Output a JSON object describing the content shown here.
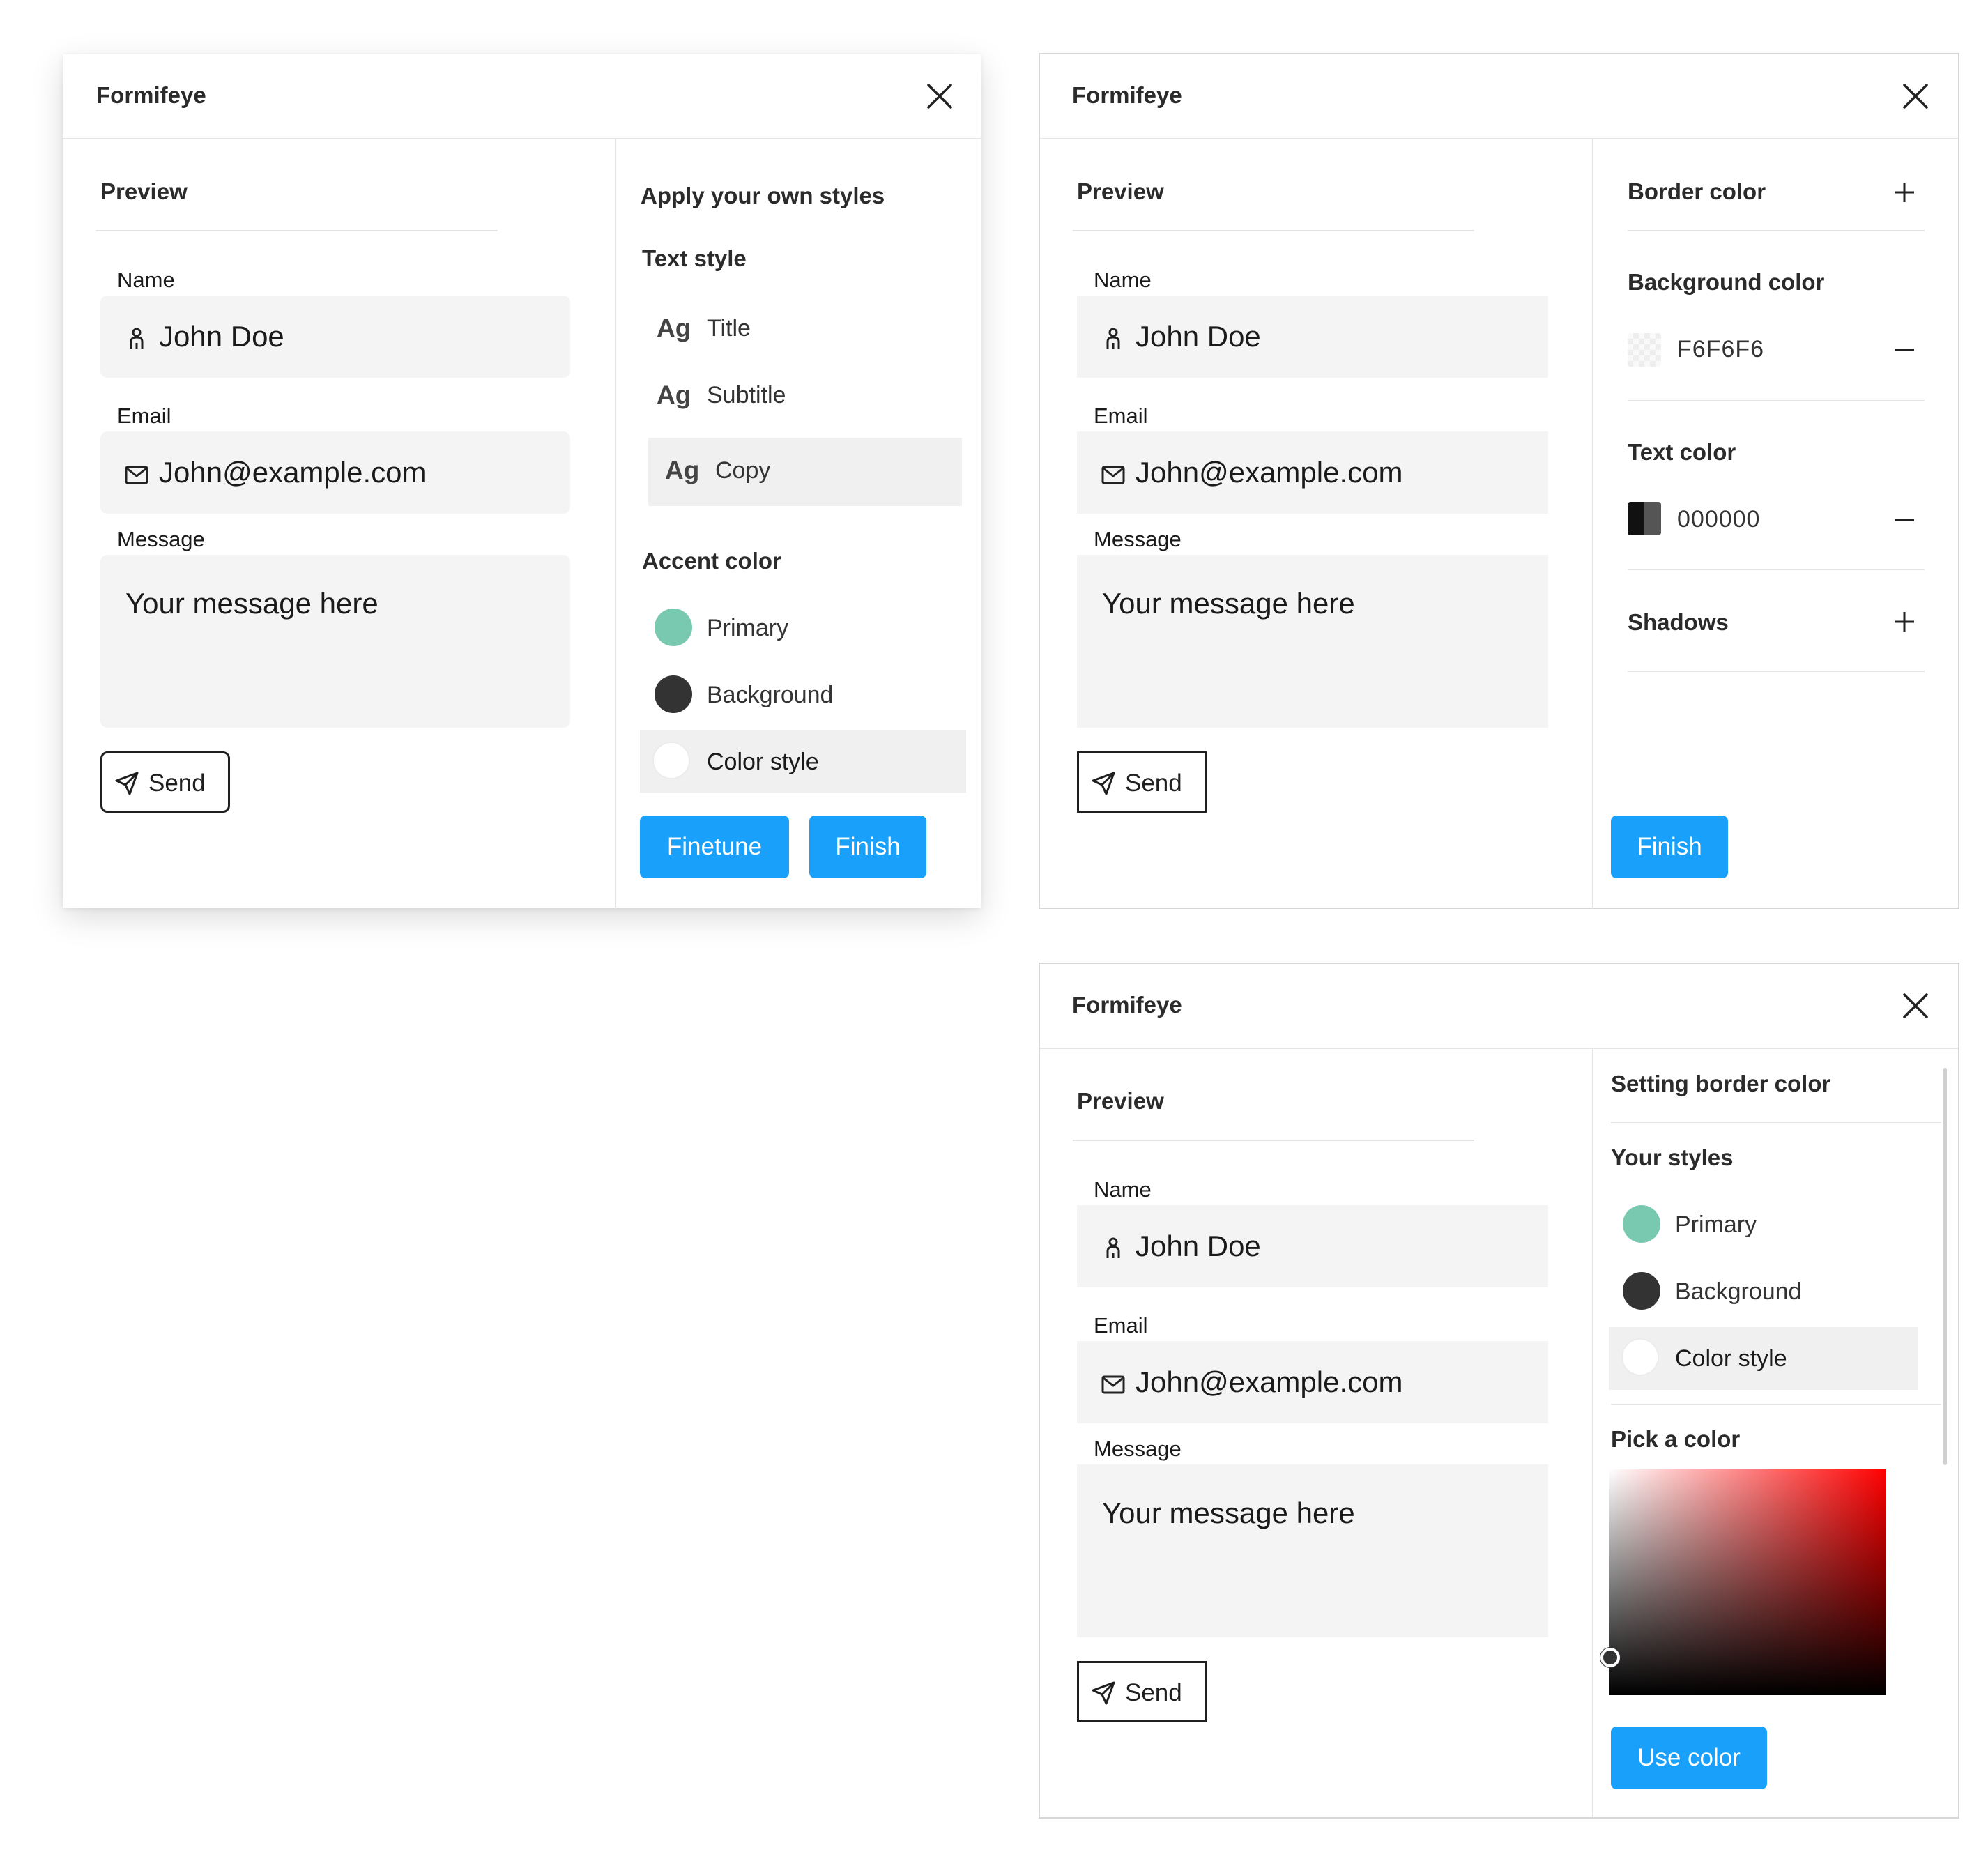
{
  "colors": {
    "accent_blue": "#18a0fb",
    "primary_teal": "#79c8b0",
    "background_dark": "#333333",
    "field_bg": "#f4f4f4",
    "highlight_bg": "#f0f0f0"
  },
  "windows": [
    {
      "title": "Formifeye",
      "preview": {
        "heading": "Preview",
        "name_label": "Name",
        "name_value": "John Doe",
        "email_label": "Email",
        "email_value": "John@example.com",
        "message_label": "Message",
        "message_value": "Your message here",
        "send_label": "Send"
      },
      "panel": {
        "heading": "Apply your own styles",
        "text_style_heading": "Text style",
        "text_styles": [
          {
            "sample": "Ag",
            "label": "Title"
          },
          {
            "sample": "Ag",
            "label": "Subtitle"
          },
          {
            "sample": "Ag",
            "label": "Copy"
          }
        ],
        "accent_heading": "Accent color",
        "accent_items": [
          "Primary",
          "Background",
          "Color style"
        ],
        "finetune_label": "Finetune",
        "finish_label": "Finish"
      }
    },
    {
      "title": "Formifeye",
      "preview": {
        "heading": "Preview",
        "name_label": "Name",
        "name_value": "John Doe",
        "email_label": "Email",
        "email_value": "John@example.com",
        "message_label": "Message",
        "message_value": "Your message here",
        "send_label": "Send"
      },
      "panel": {
        "border_color_heading": "Border color",
        "background_color_heading": "Background color",
        "background_hex": "F6F6F6",
        "text_color_heading": "Text color",
        "text_hex": "000000",
        "shadows_heading": "Shadows",
        "finish_label": "Finish"
      }
    },
    {
      "title": "Formifeye",
      "preview": {
        "heading": "Preview",
        "name_label": "Name",
        "name_value": "John Doe",
        "email_label": "Email",
        "email_value": "John@example.com",
        "message_label": "Message",
        "message_value": "Your message here",
        "send_label": "Send"
      },
      "panel": {
        "heading": "Setting border color",
        "your_styles_heading": "Your styles",
        "style_items": [
          "Primary",
          "Background",
          "Color style"
        ],
        "pick_heading": "Pick a color",
        "use_color_label": "Use color"
      }
    }
  ]
}
